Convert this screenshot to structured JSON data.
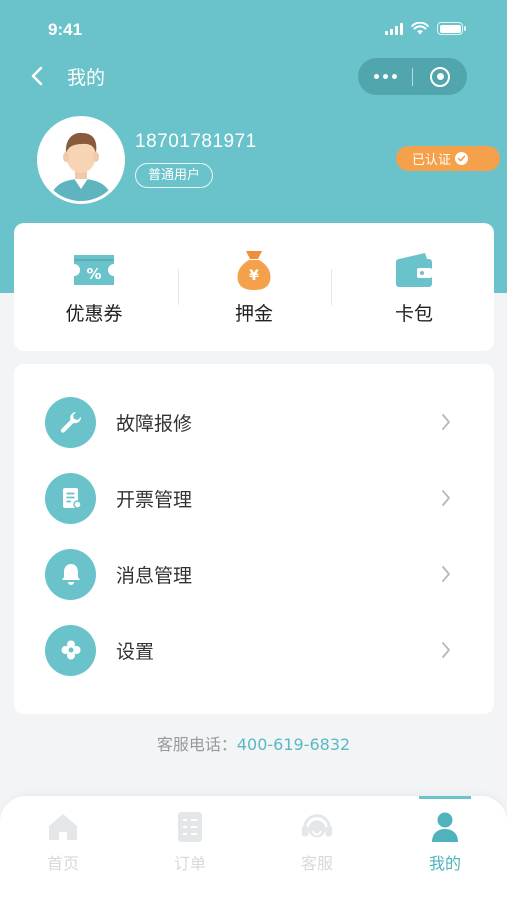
{
  "status_bar": {
    "time": "9:41"
  },
  "nav": {
    "title": "我的"
  },
  "profile": {
    "phone": "18701781971",
    "user_type": "普通用户",
    "verified_label": "已认证"
  },
  "quick_actions": [
    {
      "label": "优惠券",
      "icon": "coupon-icon"
    },
    {
      "label": "押金",
      "icon": "money-bag-icon"
    },
    {
      "label": "卡包",
      "icon": "wallet-icon"
    }
  ],
  "menu": [
    {
      "label": "故障报修",
      "icon": "wrench-icon"
    },
    {
      "label": "开票管理",
      "icon": "invoice-icon"
    },
    {
      "label": "消息管理",
      "icon": "bell-icon"
    },
    {
      "label": "设置",
      "icon": "gear-icon"
    }
  ],
  "service": {
    "label": "客服电话：",
    "phone": "400-619-6832"
  },
  "tabs": [
    {
      "label": "首页",
      "icon": "home-icon",
      "active": false
    },
    {
      "label": "订单",
      "icon": "order-icon",
      "active": false
    },
    {
      "label": "客服",
      "icon": "headset-icon",
      "active": false
    },
    {
      "label": "我的",
      "icon": "user-icon",
      "active": true
    }
  ],
  "colors": {
    "primary": "#6ac3cb",
    "accent": "#f5a04a",
    "tab_inactive": "#d6dadd"
  }
}
